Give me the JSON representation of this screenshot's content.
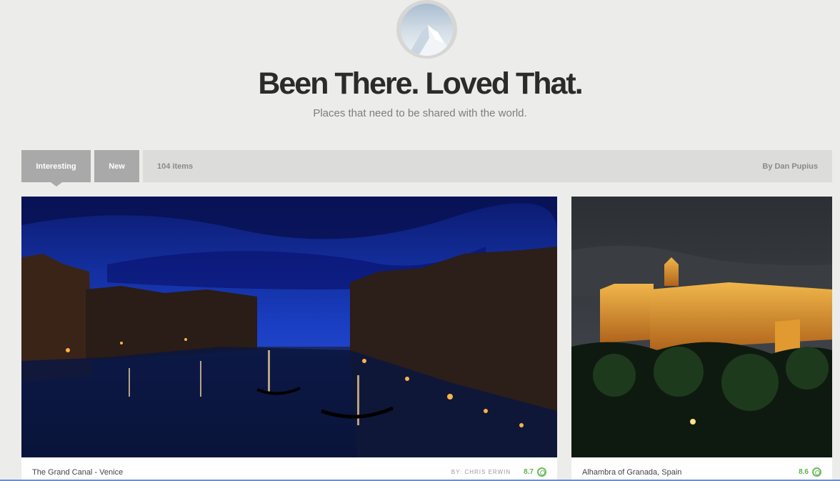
{
  "header": {
    "avatar_icon": "mountain-icon",
    "title": "Been There. Loved That.",
    "subtitle": "Places that need to be shared with the world."
  },
  "toolbar": {
    "tabs": [
      {
        "label": "Interesting",
        "active": true
      },
      {
        "label": "New",
        "active": false
      }
    ],
    "item_count": "104 items",
    "author": "By Dan Pupius"
  },
  "cards": [
    {
      "title": "The Grand Canal - Venice",
      "author": "BY: CHRIS ERWIN",
      "score": "8.7",
      "score_icon": "target-icon"
    },
    {
      "title": "Alhambra of Granada, Spain",
      "author": "",
      "score": "8.6",
      "score_icon": "target-icon"
    }
  ],
  "colors": {
    "background": "#ececea",
    "tab_bg": "#a9a9a9",
    "info_bar_bg": "#dcdcda",
    "score_green": "#5eb04f"
  }
}
